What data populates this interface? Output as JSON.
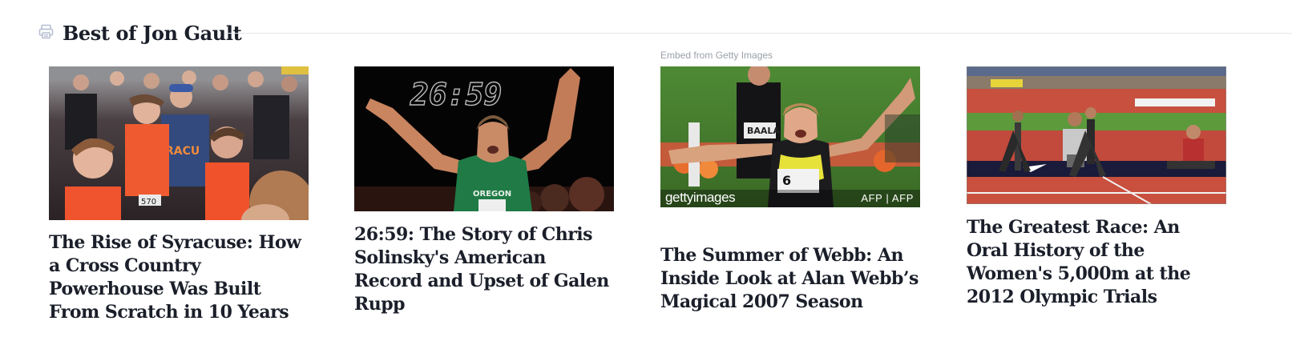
{
  "section": {
    "title": "Best of Jon Gault",
    "icon": "printer-icon"
  },
  "cards": [
    {
      "title": "The Rise of Syracuse: How a Cross Country Powerhouse Was Built From Scratch in 10 Years",
      "image": "syracuse-team-celebration-photo"
    },
    {
      "title": "26:59: The Story of Chris Solinsky's American Record and Upset of Galen Rupp",
      "image": "solinsky-record-photo",
      "image_overlay_text": "26:59"
    },
    {
      "title": "The Summer of Webb: An Inside Look at Alan Webb’s Magical 2007 Season",
      "image": "webb-celebration-photo",
      "embed_credit": "Embed from Getty Images",
      "getty_logo": "gettyimages",
      "getty_credit": "AFP | AFP"
    },
    {
      "title": "The Greatest Race: An Oral History of the Women's 5,000m at the 2012 Olympic Trials",
      "image": "olympic-trials-finish-photo"
    }
  ],
  "colors": {
    "title_text": "#1b1f2a",
    "header_rule": "#e4e7ec",
    "credit_text": "#9aa0a8",
    "icon": "#b6bfd2"
  }
}
